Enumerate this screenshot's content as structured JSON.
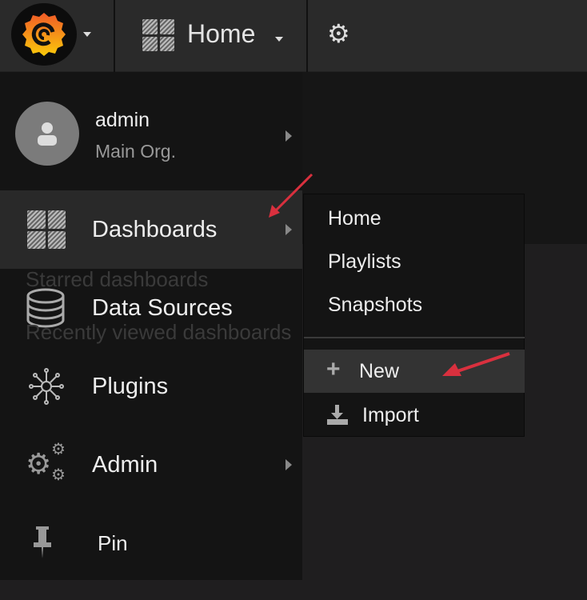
{
  "topbar": {
    "title": "Home",
    "icons": {
      "logo": "grafana-logo",
      "dashboards": "dashboards-grid-icon",
      "settings": "gear-icon"
    }
  },
  "background": {
    "starred": "Starred dashboards",
    "recent": "Recently viewed dashboards"
  },
  "user": {
    "name": "admin",
    "org": "Main Org."
  },
  "side_menu": [
    {
      "label": "Dashboards",
      "icon": "dashboards-grid-icon",
      "submenu": true,
      "active": true
    },
    {
      "label": "Data Sources",
      "icon": "database-icon",
      "submenu": false
    },
    {
      "label": "Plugins",
      "icon": "plugins-icon",
      "submenu": false
    },
    {
      "label": "Admin",
      "icon": "gears-icon",
      "submenu": true
    },
    {
      "label": "Pin",
      "icon": "pin-icon",
      "submenu": false
    }
  ],
  "dashboards_submenu": [
    {
      "label": "Home"
    },
    {
      "label": "Playlists"
    },
    {
      "label": "Snapshots"
    },
    {
      "label": "New",
      "icon": "plus-icon",
      "highlighted": true
    },
    {
      "label": "Import",
      "icon": "import-icon"
    }
  ],
  "annotation_color": "#d9303e"
}
